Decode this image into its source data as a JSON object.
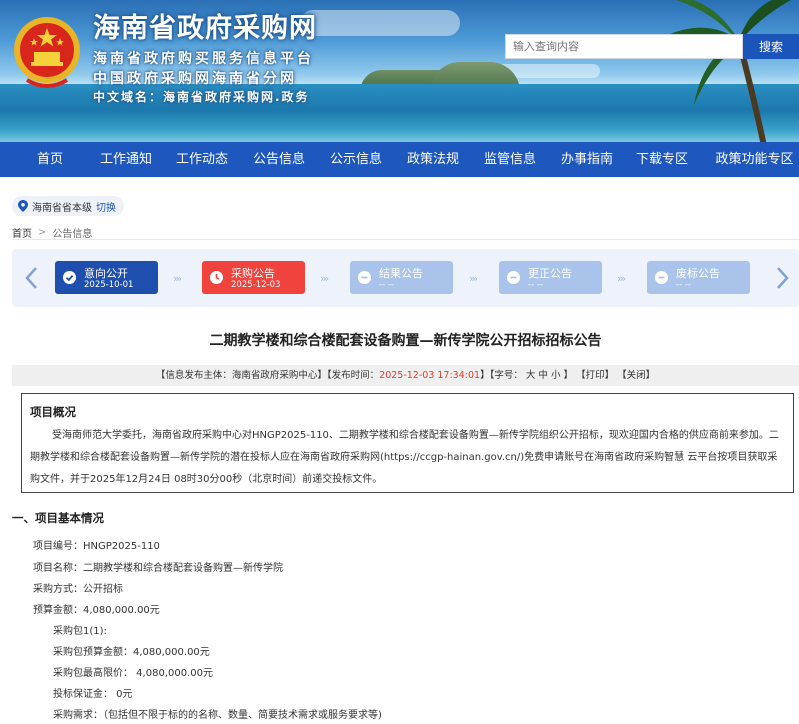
{
  "header": {
    "site_title": "海南省政府采购网",
    "subtitle1": "海南省政府购买服务信息平台",
    "subtitle2": "中国政府采购网海南省分网",
    "subtitle3": "中文域名：海南省政府采购网.政务",
    "search_placeholder": "输入查询内容",
    "search_button": "搜索"
  },
  "nav": [
    "首页",
    "工作通知",
    "工作动态",
    "公告信息",
    "公示信息",
    "政策法规",
    "监管信息",
    "办事指南",
    "下载专区",
    "政策功能专区"
  ],
  "region": {
    "name": "海南省省本级",
    "switch": "切换"
  },
  "breadcrumb": {
    "home": "首页",
    "sep": ">",
    "current": "公告信息"
  },
  "steps": [
    {
      "label": "意向公开",
      "date": "2025-10-01",
      "state": "done",
      "color": "#1e4fae"
    },
    {
      "label": "采购公告",
      "date": "2025-12-03",
      "state": "current",
      "color": "#f0433d"
    },
    {
      "label": "结果公告",
      "date": "-- --",
      "state": "pending",
      "color": "#a9c3ea"
    },
    {
      "label": "更正公告",
      "date": "-- --",
      "state": "pending",
      "color": "#a9c3ea"
    },
    {
      "label": "废标公告",
      "date": "-- --",
      "state": "pending",
      "color": "#a9c3ea"
    }
  ],
  "article": {
    "title": "二期教学楼和综合楼配套设备购置—新传学院公开招标招标公告",
    "meta_publisher": "【信息发布主体：海南省政府采购中心】",
    "meta_time_label": "【发布时间：",
    "meta_time": "2025-12-03 17:34:01",
    "meta_time_close": "】",
    "meta_font": "【字号：",
    "font_big": "大",
    "font_mid": "中",
    "font_small": "小",
    "meta_font_close": "】",
    "print": "【打印】",
    "close": "【关闭】"
  },
  "overview": {
    "heading": "项目概况",
    "text": "受海南师范大学委托，海南省政府采购中心对HNGP2025-110、二期教学楼和综合楼配套设备购置—新传学院组织公开招标，现欢迎国内合格的供应商前来参加。二期教学楼和综合楼配套设备购置—新传学院的潜在投标人应在海南省政府采购网(https://ccgp-hainan.gov.cn/)免费申请账号在海南省政府采购智慧 云平台按项目获取采购文件，并于2025年12月24日 08时30分00秒（北京时间）前递交投标文件。"
  },
  "section1": {
    "title": "一、项目基本情况",
    "project_no": "项目编号：HNGP2025-110",
    "project_name": "项目名称：二期教学楼和综合楼配套设备购置—新传学院",
    "method": "采购方式：公开招标",
    "budget": "预算金额：4,080,000.00元",
    "package": "采购包1(1):",
    "pkg_budget": "采购包预算金额：4,080,000.00元",
    "pkg_max": "采购包最高限价： 4,080,000.00元",
    "bond": "投标保证金： 0元",
    "demand": "采购需求：（包括但不限于标的的名称、数量、简要技术需求或服务要求等)"
  }
}
